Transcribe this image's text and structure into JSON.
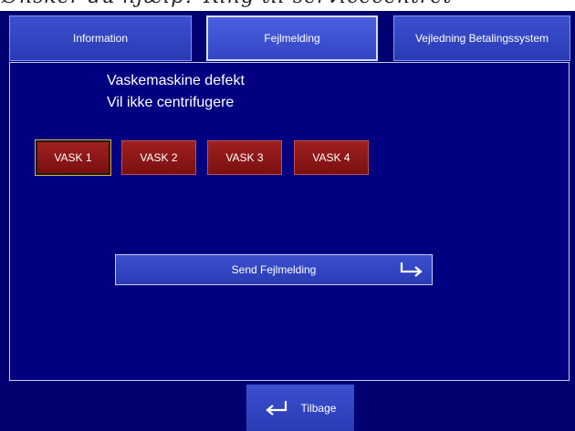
{
  "top_strip": {
    "text": "Ønsker du hjælp? Ring til servicecentret"
  },
  "tabs": [
    {
      "label": "Information"
    },
    {
      "label": "Fejlmelding"
    },
    {
      "label": "Vejledning Betalingssystem"
    }
  ],
  "message": {
    "line1": "Vaskemaskine defekt",
    "line2": "Vil ikke centrifugere"
  },
  "machines": [
    {
      "label": "VASK 1"
    },
    {
      "label": "VASK 2"
    },
    {
      "label": "VASK 3"
    },
    {
      "label": "VASK 4"
    }
  ],
  "send_button": {
    "label": "Send Fejlmelding",
    "icon": "enter-arrow-icon"
  },
  "back_button": {
    "label": "Tilbage",
    "icon": "return-arrow-icon"
  },
  "colors": {
    "background": "#000070",
    "tab": "#3246c4",
    "machine_button": "#8b1a1a"
  }
}
